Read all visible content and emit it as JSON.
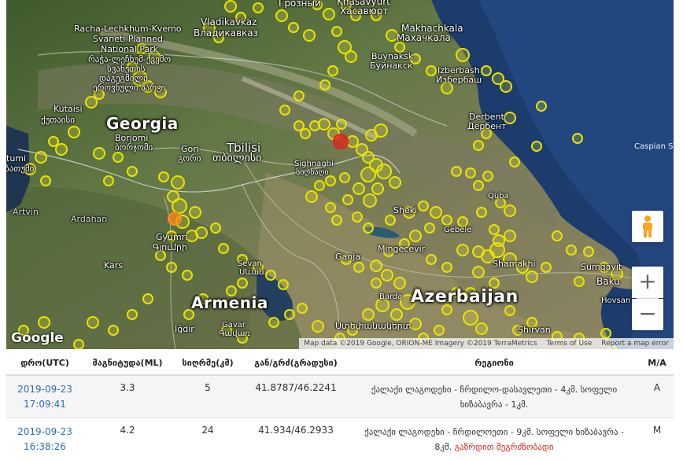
{
  "map": {
    "places": [
      {
        "id": "groznyy",
        "text": "Грозный"
      },
      {
        "id": "khasavyurt-ka",
        "text": "Khasavyurt"
      },
      {
        "id": "khasavyurt-ru",
        "text": "Хасавюрт"
      },
      {
        "id": "vladikavkaz-en",
        "text": "Vladikavkaz"
      },
      {
        "id": "vladikavkaz-ru",
        "text": "Владикавказ"
      },
      {
        "id": "park-1",
        "text": "Racha-Lechkhum-Kvemo"
      },
      {
        "id": "park-2",
        "text": "Svaneti Planned"
      },
      {
        "id": "park-3",
        "text": "National Park"
      },
      {
        "id": "park-ka-1",
        "text": "რაჭა-ლეჩხუმ-ქვემო"
      },
      {
        "id": "park-ka-2",
        "text": "სვანეთის"
      },
      {
        "id": "park-ka-3",
        "text": "დაგეგმილი"
      },
      {
        "id": "park-ka-4",
        "text": "ეროვნული პარკი"
      },
      {
        "id": "makhachkala-en",
        "text": "Makhachkala"
      },
      {
        "id": "makhachkala-ru",
        "text": "Махачкала"
      },
      {
        "id": "buynaksk-en",
        "text": "Buynaksk"
      },
      {
        "id": "buynaksk-ru",
        "text": "Буйнакск"
      },
      {
        "id": "izberbash-en",
        "text": "Izberbash"
      },
      {
        "id": "izberbash-ru",
        "text": "Избербаш"
      },
      {
        "id": "derbent-en",
        "text": "Derbent"
      },
      {
        "id": "derbent-ru",
        "text": "Дербент"
      },
      {
        "id": "kutaisi-en",
        "text": "Kutaisi"
      },
      {
        "id": "kutaisi-ka",
        "text": "ქუთაისი"
      },
      {
        "id": "borjomi-en",
        "text": "Borjomi"
      },
      {
        "id": "borjomi-ka",
        "text": "ბორჯომი"
      },
      {
        "id": "gori-en",
        "text": "Gori"
      },
      {
        "id": "gori-ka",
        "text": "გორი"
      },
      {
        "id": "tbilisi-en",
        "text": "Tbilisi"
      },
      {
        "id": "tbilisi-ka",
        "text": "თბილისი"
      },
      {
        "id": "signaghi-en",
        "text": "Sighnaghi"
      },
      {
        "id": "signaghi-ka",
        "text": "სიღნაღი"
      },
      {
        "id": "caspian",
        "text": "Caspian S"
      },
      {
        "id": "batumi-frag",
        "text": "tumi"
      },
      {
        "id": "batumi-frag-ka",
        "text": "ბათუმი"
      },
      {
        "id": "artvin",
        "text": "Artvin"
      },
      {
        "id": "ardahan",
        "text": "Ardahan"
      },
      {
        "id": "gyumri-en",
        "text": "Gyumri"
      },
      {
        "id": "gyumri-hy",
        "text": "Գյումրի"
      },
      {
        "id": "kars",
        "text": "Kars"
      },
      {
        "id": "sevan-en",
        "text": "Sevan"
      },
      {
        "id": "sevan-hy",
        "text": "Սևան"
      },
      {
        "id": "ganja",
        "text": "Ganja"
      },
      {
        "id": "sheki",
        "text": "Sheki"
      },
      {
        "id": "gebele",
        "text": "Gebele"
      },
      {
        "id": "qusar",
        "text": "Quba"
      },
      {
        "id": "mingecevir",
        "text": "Mingecevir"
      },
      {
        "id": "shamakhi",
        "text": "Shamakhi"
      },
      {
        "id": "sumqayit",
        "text": "Sumqayit"
      },
      {
        "id": "baku",
        "text": "Baku"
      },
      {
        "id": "hovsan",
        "text": "Hovsan"
      },
      {
        "id": "barda",
        "text": "Barda"
      },
      {
        "id": "shirvan",
        "text": "Shirvan"
      },
      {
        "id": "igdir",
        "text": "Iğdir"
      },
      {
        "id": "gavar-en",
        "text": "Gavar"
      },
      {
        "id": "gavar-hy",
        "text": "Գավառ"
      },
      {
        "id": "stepanakert-frag",
        "text": "Ստեփանակերտ"
      }
    ],
    "countries": {
      "georgia": "Georgia",
      "armenia": "Armenia",
      "azerbaijan": "Azerbaijan"
    },
    "google_logo": "Google",
    "attribution": {
      "data": "Map data ©2019 Google, ORION-ME Imagery ©2019 TerraMetrics",
      "terms": "Terms of Use",
      "report": "Report a map error"
    },
    "controls": {
      "zoom_in": "+",
      "zoom_out": "−"
    },
    "markers": {
      "yellow_fill": "#f2ee2b",
      "yellow_stroke": "#e8e400",
      "red": "#e2231a",
      "orange": "#ff8c1a"
    }
  },
  "table": {
    "headers": {
      "time": "დრო(UTC)",
      "magnitude": "მაგნიტუდა(ML)",
      "depth": "სიღრმე(კმ)",
      "latlon": "გან/გრძ(გრადუსი)",
      "region": "რეგიონი",
      "ma": "M/A"
    },
    "rows": [
      {
        "date": "2019-09-23",
        "time": "17:09:41",
        "magnitude": "3.3",
        "depth": "5",
        "latlon": "41.8787/46.2241",
        "region": "ქალაქი ლაგოდეხი - ჩრდილო-დასავლეთი - 4კმ. სოფელი ხიზაბავრა - 1კმ.",
        "felt": "",
        "ma": "A"
      },
      {
        "date": "2019-09-23",
        "time": "16:38:26",
        "magnitude": "4.2",
        "depth": "24",
        "latlon": "41.934/46.2933",
        "region": "ქალაქი ლაგოდეხი - ჩრდილოეთი - 9კმ. სოფელი ხიზაბავრა - 8კმ.",
        "felt": "გაზრდით შეგრძნობადი",
        "ma": "M"
      }
    ]
  }
}
